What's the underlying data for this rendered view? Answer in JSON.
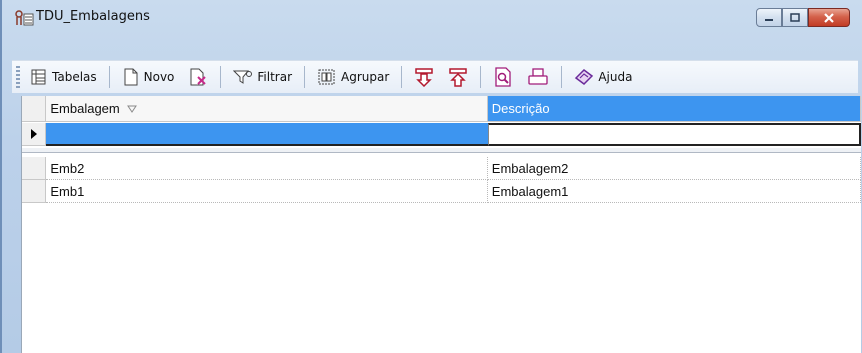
{
  "window": {
    "title": "TDU_Embalagens"
  },
  "toolbar": {
    "tabelas": "Tabelas",
    "novo": "Novo",
    "filtrar": "Filtrar",
    "agrupar": "Agrupar",
    "ajuda": "Ajuda"
  },
  "grid": {
    "columns": [
      "Embalagem",
      "Descrição"
    ],
    "sorted_column": "Embalagem",
    "selected_column": "Descrição",
    "new_row": {
      "embalagem": "",
      "descricao": ""
    },
    "rows": [
      {
        "embalagem": "Emb2",
        "descricao": "Embalagem2"
      },
      {
        "embalagem": "Emb1",
        "descricao": "Embalagem1"
      }
    ]
  },
  "colors": {
    "selection": "#3d95f0",
    "close_button": "#c94a33",
    "frame": "#bcd1ea"
  },
  "icons": [
    "form-icon",
    "minimize-icon",
    "maximize-icon",
    "close-icon",
    "table-icon",
    "new-document-icon",
    "delete-document-icon",
    "filter-icon",
    "group-icon",
    "move-down-icon",
    "move-up-icon",
    "print-preview-icon",
    "print-icon",
    "help-icon",
    "row-pointer-icon",
    "sort-icon"
  ]
}
